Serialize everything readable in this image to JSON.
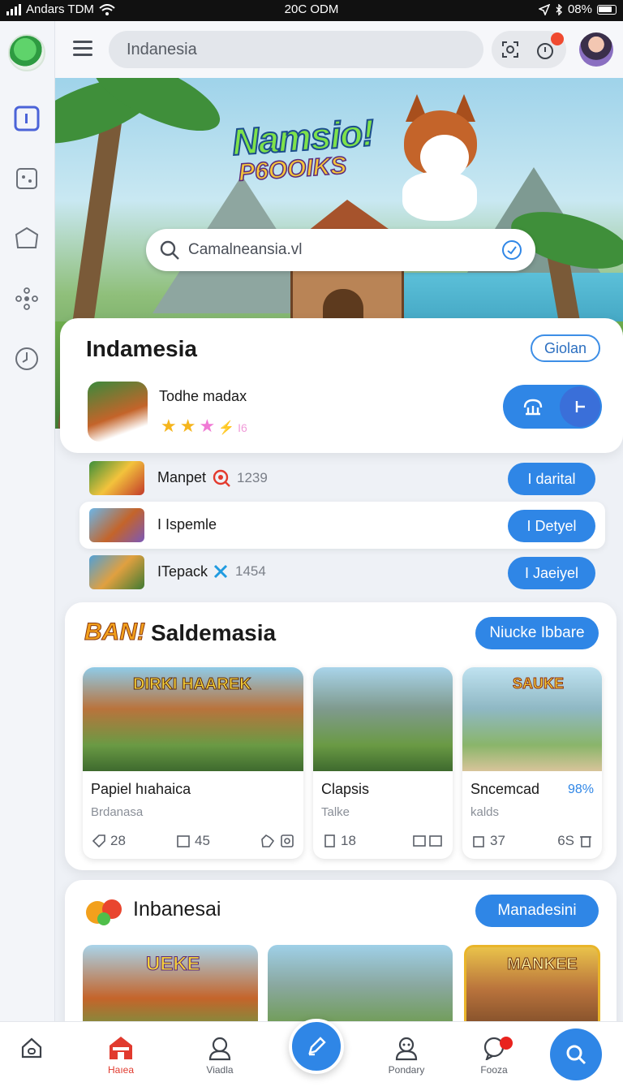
{
  "status_bar": {
    "carrier": "Andars TDM",
    "time": "20C ODM",
    "battery": "08%"
  },
  "top_bar": {
    "search_value": "Indanesia",
    "notification_count": ""
  },
  "hero": {
    "title_line1": "Namsio!",
    "title_line2": "P6OOIKS",
    "search_value": "Camalneansia.vl"
  },
  "featured": {
    "title": "Indamesia",
    "action_label": "Giolan",
    "app_name": "Todhe madax",
    "rating_count": "I6"
  },
  "list": [
    {
      "name": "Manpet",
      "count": "1239",
      "button": "I darital"
    },
    {
      "name": "I Ispemle",
      "count": "",
      "button": "I Detyel"
    },
    {
      "name": "ITepack",
      "count": "1454",
      "button": "I Jaeiyel"
    }
  ],
  "section1": {
    "badge": "BAN!",
    "title": "Saldemasia",
    "action_label": "Niucke Ibbare",
    "games": [
      {
        "title": "Papiel hıahaica",
        "subtitle": "Brdanasa",
        "stat1": "28",
        "stat2": "45",
        "percent": "",
        "art_text": "DIRKI HAAREK"
      },
      {
        "title": "Clapsis",
        "subtitle": "Talke",
        "stat1": "18",
        "stat2": "",
        "percent": "",
        "art_text": ""
      },
      {
        "title": "Sncemcad",
        "subtitle": "kalds",
        "stat1": "37",
        "stat2": "",
        "stat2_prefix": "6S",
        "percent": "98%",
        "art_text": "SAUKE"
      }
    ]
  },
  "section2": {
    "title": "Inbanesai",
    "action_label": "Manadesini",
    "thumb_texts": [
      "UEKE",
      "",
      "MANKEE"
    ]
  },
  "bottom_nav": {
    "items": [
      {
        "label": ""
      },
      {
        "label": "Haıea"
      },
      {
        "label": "Viadla"
      },
      {
        "label": "Pondary"
      },
      {
        "label": "Fooza"
      }
    ]
  },
  "colors": {
    "accent": "#2f86e6",
    "active_nav": "#e13a2e",
    "badge_red": "#f04a30"
  }
}
